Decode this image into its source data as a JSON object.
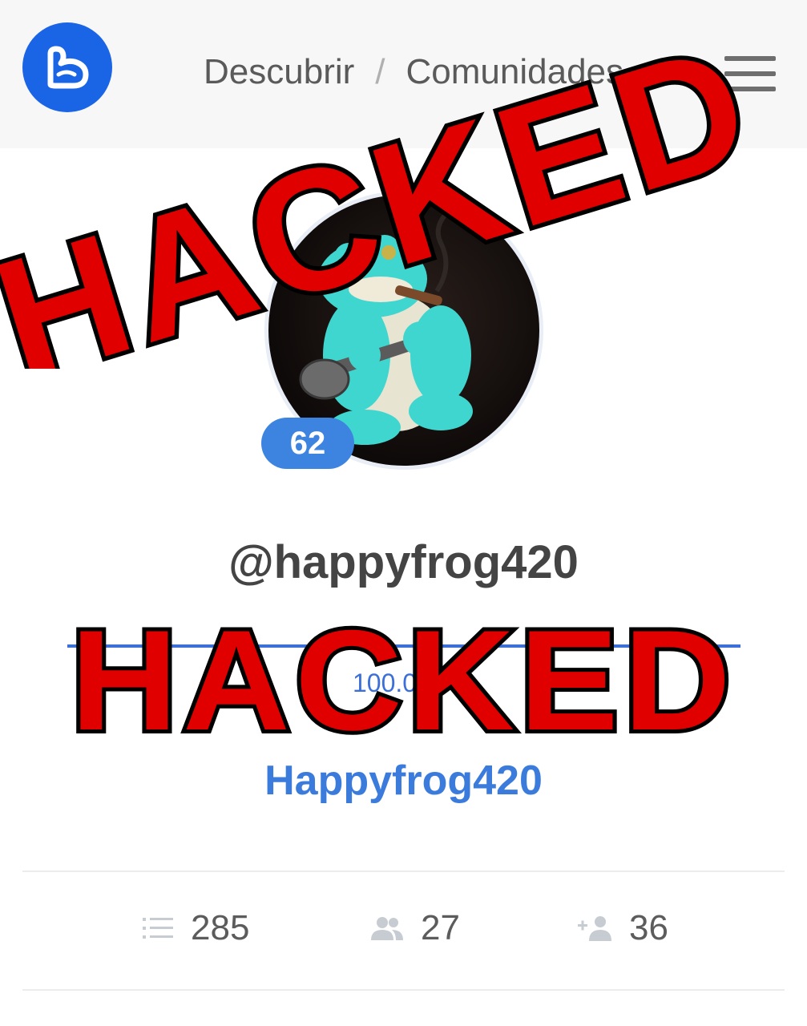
{
  "header": {
    "logo_icon": "app-logo-icon",
    "breadcrumb": [
      "Descubrir",
      "Comunidades"
    ],
    "breadcrumb_separator": "/",
    "menu_icon": "hamburger-menu-icon"
  },
  "profile": {
    "reputation": "62",
    "username": "@happyfrog420",
    "voting_power": "100.0",
    "display_name": "Happyfrog420",
    "avatar_icon": "frog-avatar-image"
  },
  "stats": [
    {
      "icon": "list-icon",
      "value": "285"
    },
    {
      "icon": "followers-icon",
      "value": "27"
    },
    {
      "icon": "following-icon",
      "value": "36"
    }
  ],
  "overlay": {
    "text": "HACKED",
    "color": "#e00000",
    "outline": "#000000"
  },
  "colors": {
    "brand": "#1a64e6",
    "accent": "#3b7bdc",
    "badge": "#3d83e0"
  }
}
